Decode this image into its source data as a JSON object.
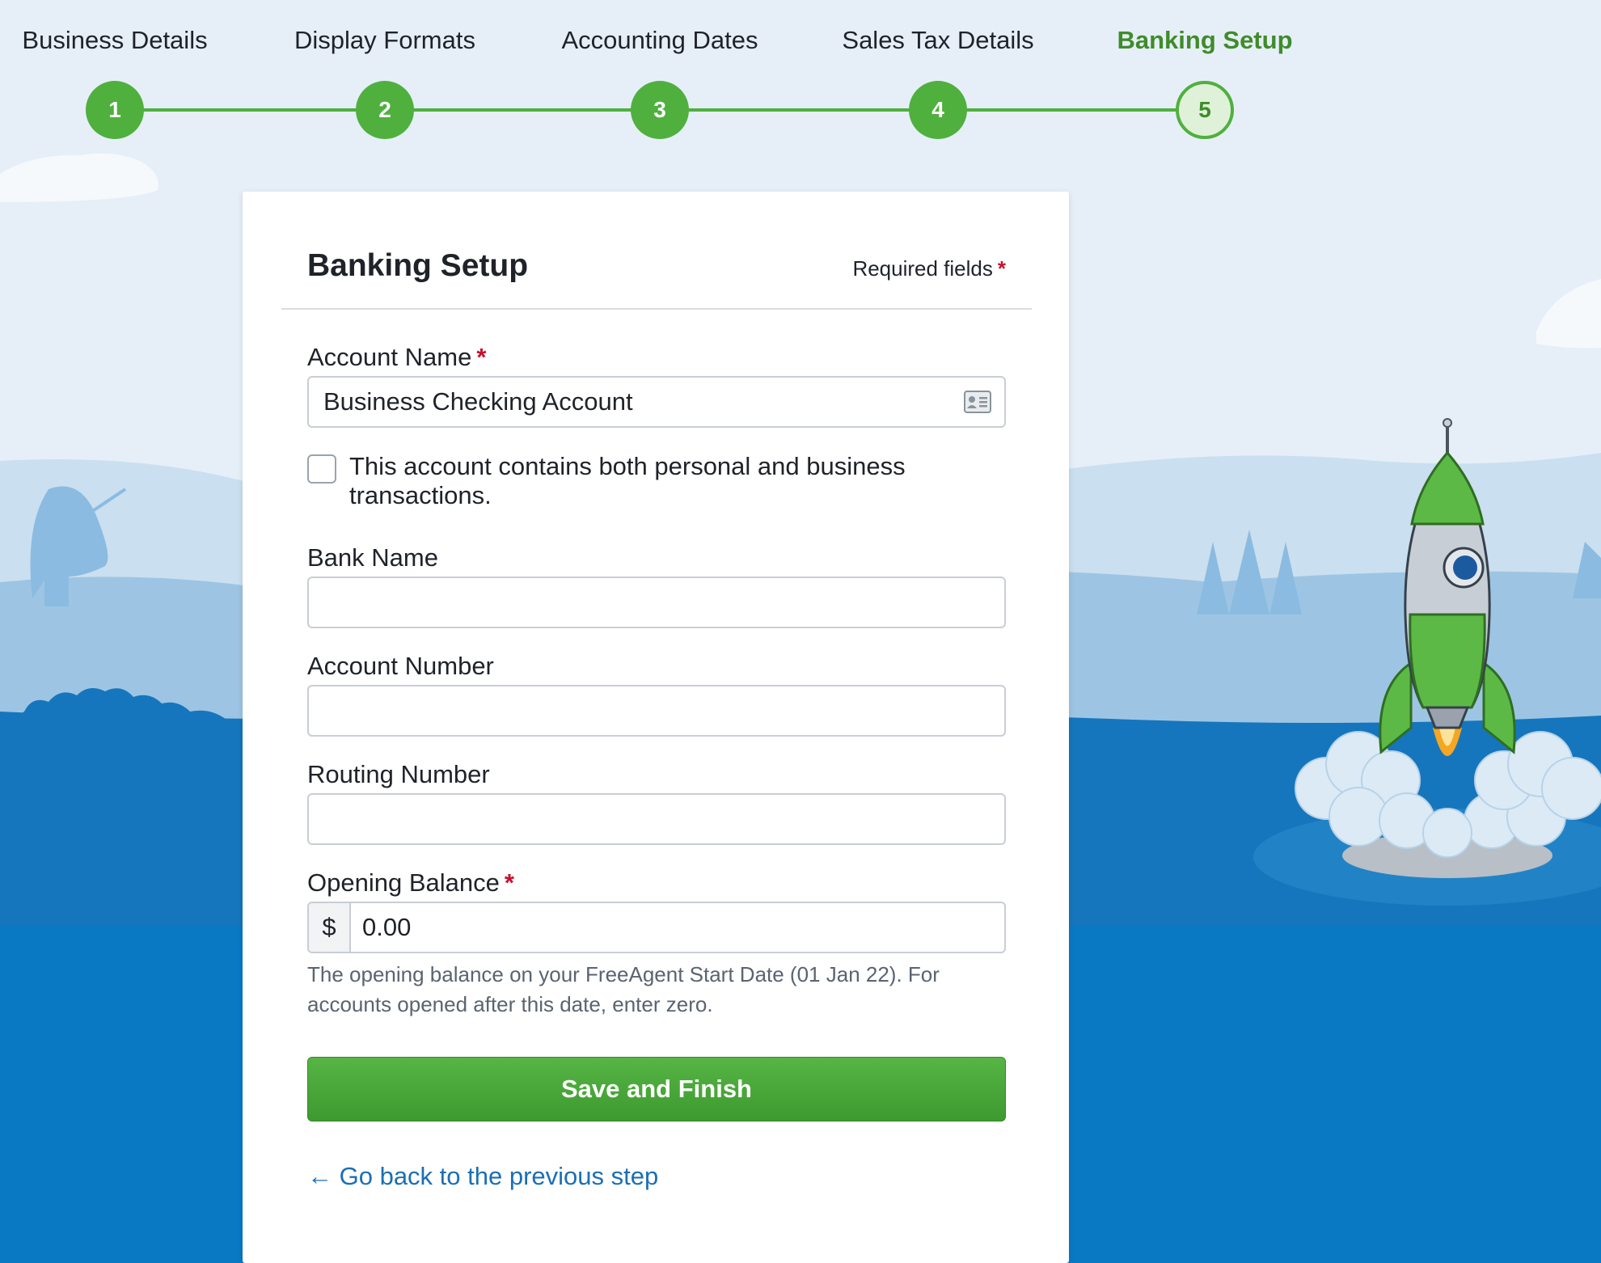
{
  "stepper": {
    "steps": [
      {
        "label": "Business Details",
        "number": "1"
      },
      {
        "label": "Display Formats",
        "number": "2"
      },
      {
        "label": "Accounting Dates",
        "number": "3"
      },
      {
        "label": "Sales Tax Details",
        "number": "4"
      },
      {
        "label": "Banking Setup",
        "number": "5"
      }
    ],
    "active_step": 5
  },
  "card": {
    "title": "Banking Setup",
    "required_note": "Required fields",
    "required_marker": "*"
  },
  "form": {
    "account_name": {
      "label": "Account Name",
      "value": "Business Checking Account",
      "required_marker": "*"
    },
    "mixed_account": {
      "label": "This account contains both personal and business transactions.",
      "checked": false
    },
    "bank_name": {
      "label": "Bank Name",
      "value": ""
    },
    "account_number": {
      "label": "Account Number",
      "value": ""
    },
    "routing_number": {
      "label": "Routing Number",
      "value": ""
    },
    "opening_balance": {
      "label": "Opening Balance",
      "required_marker": "*",
      "currency": "$",
      "value": "0.00",
      "help": "The opening balance on your FreeAgent Start Date (01 Jan 22). For accounts opened after this date, enter zero."
    },
    "save_label": "Save and Finish",
    "back_label": "← Go back to the previous step"
  },
  "colors": {
    "accent_green": "#4fb03e",
    "active_text": "#3f8c2a",
    "link_blue": "#1a6fb5",
    "required_red": "#c8102e",
    "sea_blue": "#0a79c4"
  },
  "icons": {
    "account_name_field": "contact-card-icon",
    "illustration": "rocket-illustration"
  }
}
